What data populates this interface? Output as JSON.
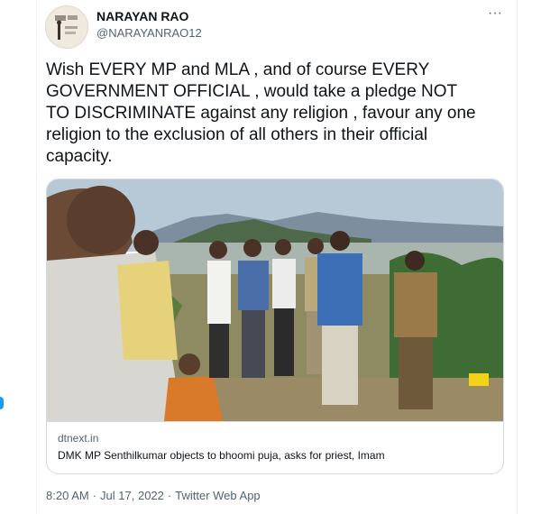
{
  "tweet": {
    "author": {
      "display_name": "NARAYAN RAO",
      "handle": "@NARAYANRAO12",
      "avatar_icon": "avatar-image"
    },
    "more_icon": "more-options-icon",
    "more_label": "···",
    "text": "Wish EVERY MP and MLA , and of course EVERY\nGOVERNMENT OFFICIAL , would take a pledge NOT\nTO DISCRIMINATE against any religion , favour any one\nreligion to the exclusion of all others in their official\ncapacity.",
    "link_card": {
      "domain": "dtnext.in",
      "title": "DMK MP Senthilkumar objects to bhoomi puja, asks for priest, Imam",
      "image_description": "photo"
    },
    "meta": {
      "time": "8:20 AM",
      "separator": "·",
      "date": "Jul 17, 2022",
      "source": "Twitter Web App"
    }
  },
  "colors": {
    "text_primary": "#0f1419",
    "text_secondary": "#536471",
    "border": "#cfd9de",
    "accent": "#1d9bf0"
  }
}
